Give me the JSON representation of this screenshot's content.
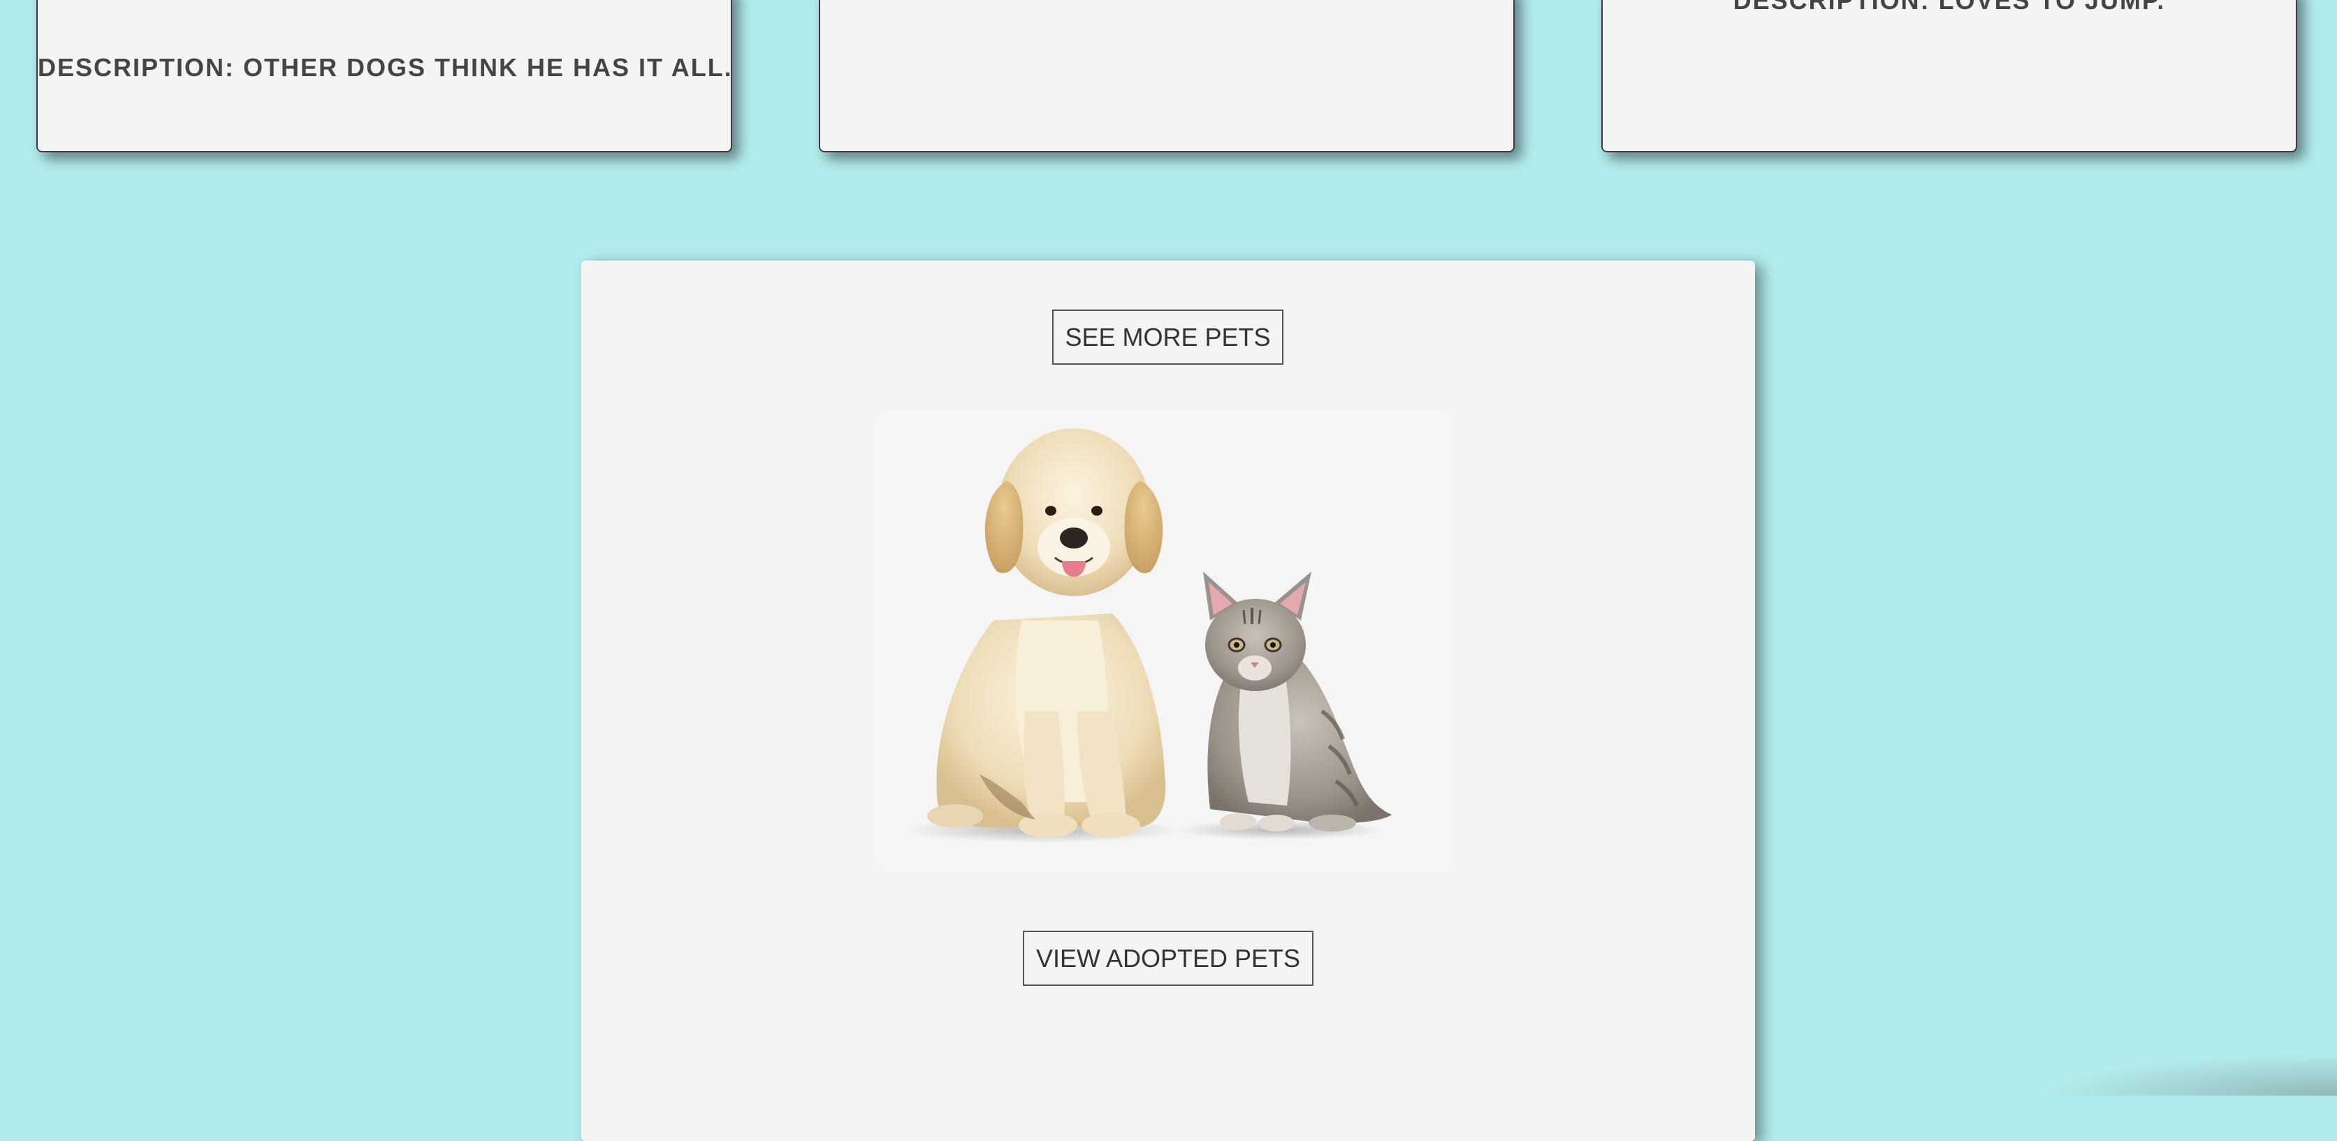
{
  "cards": [
    {
      "description": "Description: Other dogs think he has it all."
    },
    {
      "description": ""
    },
    {
      "description": "Description: Loves to jump."
    }
  ],
  "main": {
    "see_more_label": "SEE MORE PETS",
    "view_adopted_label": "VIEW ADOPTED PETS",
    "image_alt": "Puppy and kitten"
  },
  "colors": {
    "background": "#b2ebeb",
    "panel": "#f4f4f4",
    "text": "#3a3a3a"
  }
}
